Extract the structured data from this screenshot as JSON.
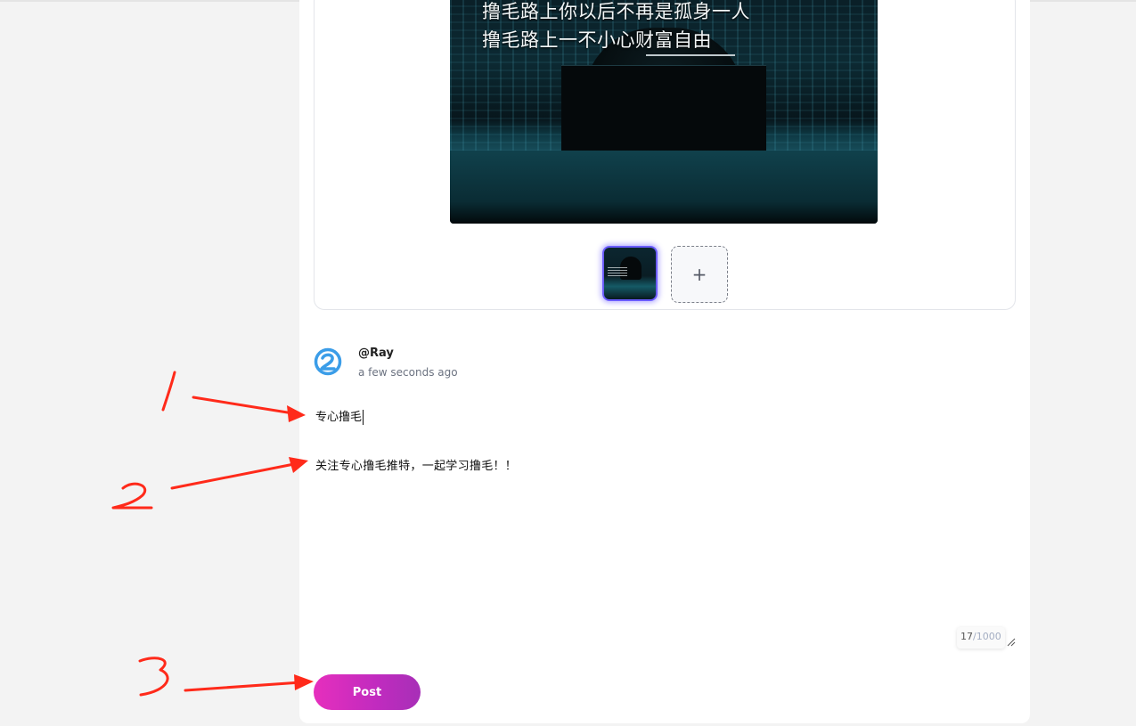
{
  "image": {
    "caption_line1": "撸毛路上你以后不再是孤身一人",
    "caption_line2": "撸毛路上一不小心财富自由"
  },
  "upload": {
    "add_label": "+"
  },
  "post": {
    "username": "@Ray",
    "timestamp": "a few seconds ago",
    "title": "专心撸毛",
    "body": "关注专心撸毛推特，一起学习撸毛！！",
    "char_count": "17",
    "char_max": "/1000",
    "button_label": "Post"
  },
  "annotations": {
    "color": "#ff2a1a",
    "labels": [
      "1",
      "2",
      "3"
    ]
  }
}
